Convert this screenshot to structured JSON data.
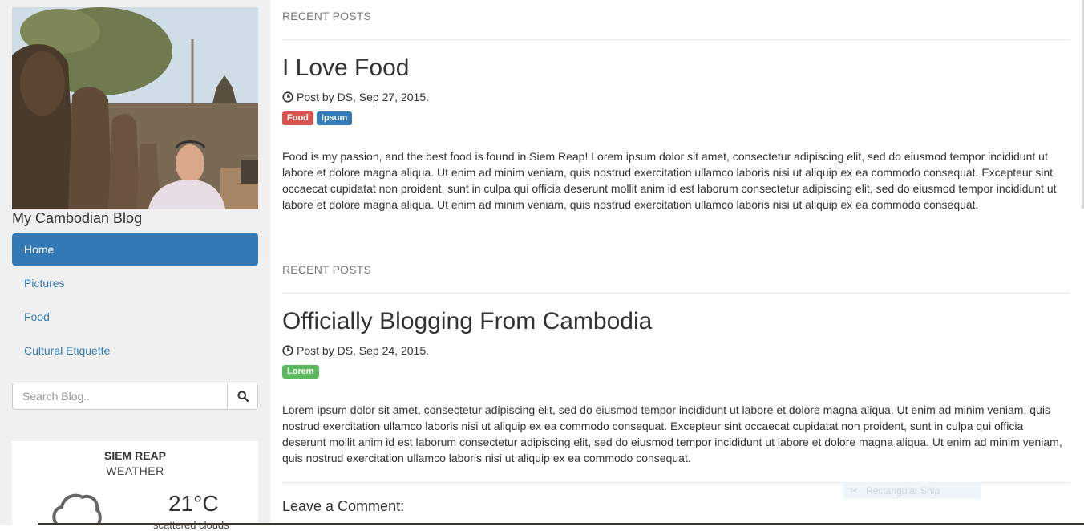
{
  "sidebar": {
    "blog_title": "My Cambodian Blog",
    "nav": [
      {
        "label": "Home",
        "active": true
      },
      {
        "label": "Pictures",
        "active": false
      },
      {
        "label": "Food",
        "active": false
      },
      {
        "label": "Cultural Etiquette",
        "active": false
      }
    ],
    "search_placeholder": "Search Blog..",
    "search_icon": "search-icon",
    "weather": {
      "city": "SIEM REAP",
      "label": "WEATHER",
      "temperature": "21°C",
      "description": "scattered clouds",
      "icon": "cloud-icon"
    }
  },
  "posts": [
    {
      "section_label": "RECENT POSTS",
      "title": "I Love Food",
      "meta": "Post by DS, Sep 27, 2015.",
      "tags": [
        {
          "label": "Food",
          "color": "#d9534f"
        },
        {
          "label": "Ipsum",
          "color": "#337ab7"
        }
      ],
      "body": "Food is my passion, and the best food is found in Siem Reap! Lorem ipsum dolor sit amet, consectetur adipiscing elit, sed do eiusmod tempor incididunt ut labore et dolore magna aliqua. Ut enim ad minim veniam, quis nostrud exercitation ullamco laboris nisi ut aliquip ex ea commodo consequat. Excepteur sint occaecat cupidatat non proident, sunt in culpa qui officia deserunt mollit anim id est laborum consectetur adipiscing elit, sed do eiusmod tempor incididunt ut labore et dolore magna aliqua. Ut enim ad minim veniam, quis nostrud exercitation ullamco laboris nisi ut aliquip ex ea commodo consequat."
    },
    {
      "section_label": "RECENT POSTS",
      "title": "Officially Blogging From Cambodia",
      "meta": "Post by DS, Sep 24, 2015.",
      "tags": [
        {
          "label": "Lorem",
          "color": "#5cb85c"
        }
      ],
      "body": "Lorem ipsum dolor sit amet, consectetur adipiscing elit, sed do eiusmod tempor incididunt ut labore et dolore magna aliqua. Ut enim ad minim veniam, quis nostrud exercitation ullamco laboris nisi ut aliquip ex ea commodo consequat. Excepteur sint occaecat cupidatat non proident, sunt in culpa qui officia deserunt mollit anim id est laborum consectetur adipiscing elit, sed do eiusmod tempor incididunt ut labore et dolore magna aliqua. Ut enim ad minim veniam, quis nostrud exercitation ullamco laboris nisi ut aliquip ex ea commodo consequat."
    }
  ],
  "comment_heading": "Leave a Comment:",
  "snip_overlay": "Rectangular Snip",
  "colors": {
    "primary": "#337ab7",
    "sidebar_bg": "#f0f0f0"
  }
}
